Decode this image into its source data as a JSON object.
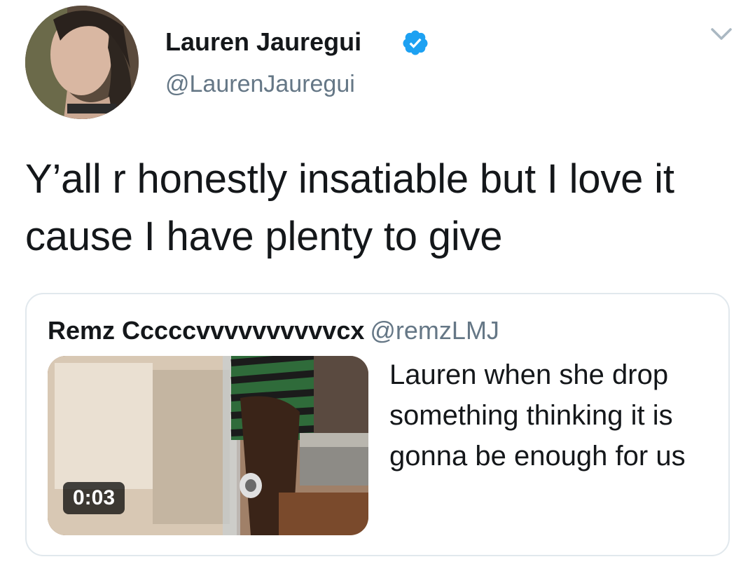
{
  "tweet": {
    "author": {
      "display_name": "Lauren Jauregui",
      "handle": "@LaurenJauregui",
      "verified_icon": "verified-badge-icon",
      "avatar": "profile-photo"
    },
    "text": "Y’all r honestly insatiable but I love it cause I have plenty to give",
    "menu_icon": "chevron-down-icon",
    "quoted_tweet": {
      "author_name": "Remz Cccccvvvvvvvvvvcx",
      "author_handle": "@remzLMJ",
      "text": "Lauren when she drop something thinking it is gonna be enough for us",
      "media": {
        "type": "video",
        "duration": "0:03"
      }
    }
  },
  "colors": {
    "text_primary": "#14171a",
    "text_secondary": "#657786",
    "verified_blue": "#1da1f2",
    "border": "#e1e8ed"
  }
}
